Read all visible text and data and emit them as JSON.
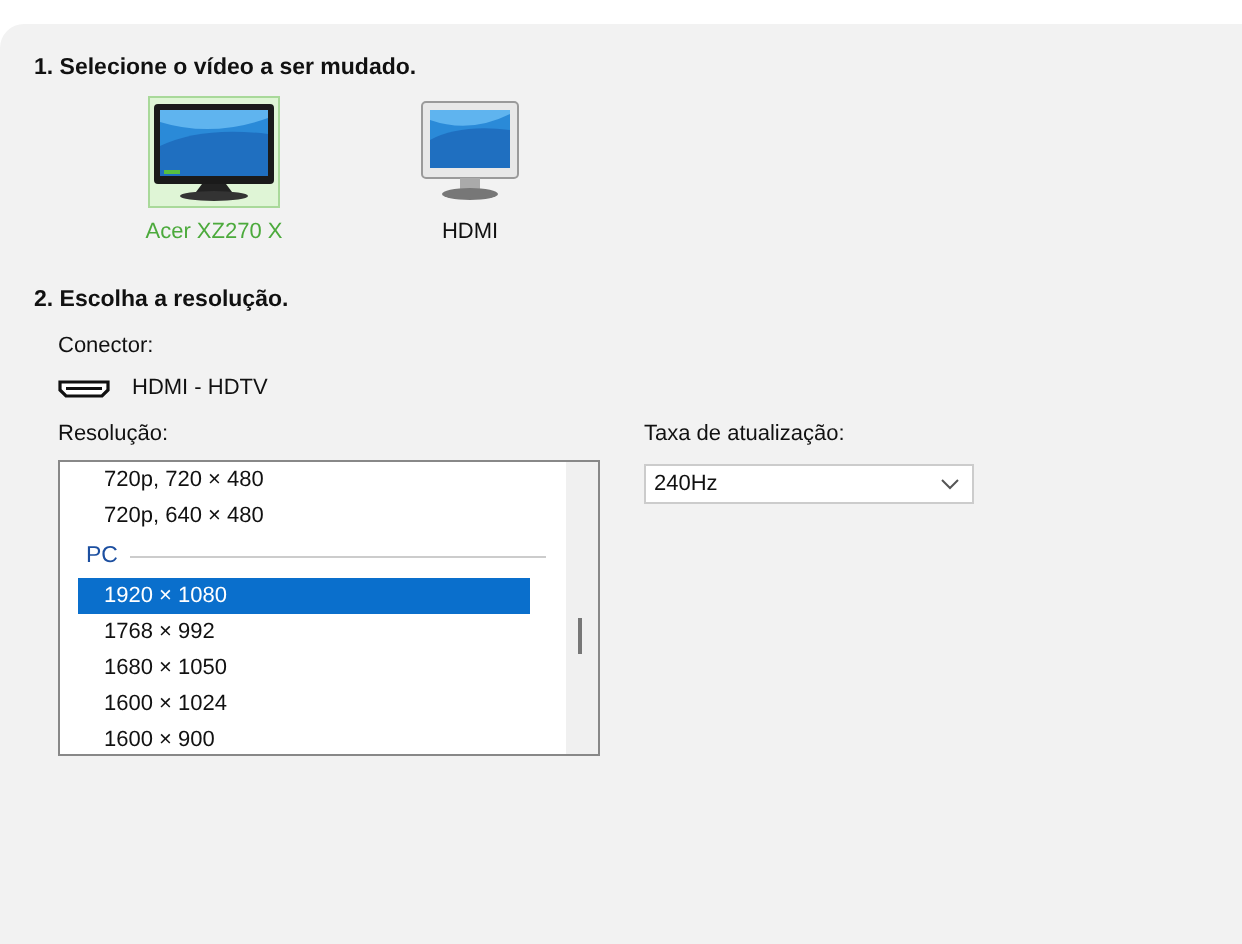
{
  "step_1": {
    "heading": "1. Selecione o vídeo a ser mudado.",
    "displays": [
      {
        "label": "Acer XZ270 X",
        "kind": "flat",
        "selected": true
      },
      {
        "label": "HDMI",
        "kind": "classic",
        "selected": false
      }
    ]
  },
  "step_2": {
    "heading": "2. Escolha a resolução.",
    "connector_label": "Conector:",
    "connector": "HDMI - HDTV",
    "resolution_label": "Resolução:",
    "resolutions": [
      {
        "kind": "item",
        "text": "720p, 720 × 480",
        "selected": false
      },
      {
        "kind": "item",
        "text": "720p, 640 × 480",
        "selected": false
      },
      {
        "kind": "group",
        "text": "PC"
      },
      {
        "kind": "item",
        "text": "1920 × 1080",
        "selected": true
      },
      {
        "kind": "item",
        "text": "1768 × 992",
        "selected": false
      },
      {
        "kind": "item",
        "text": "1680 × 1050",
        "selected": false
      },
      {
        "kind": "item",
        "text": "1600 × 1024",
        "selected": false
      },
      {
        "kind": "item",
        "text": "1600 × 900",
        "selected": false
      }
    ],
    "refresh_label": "Taxa de atualização:",
    "refresh_rate": "240Hz"
  }
}
